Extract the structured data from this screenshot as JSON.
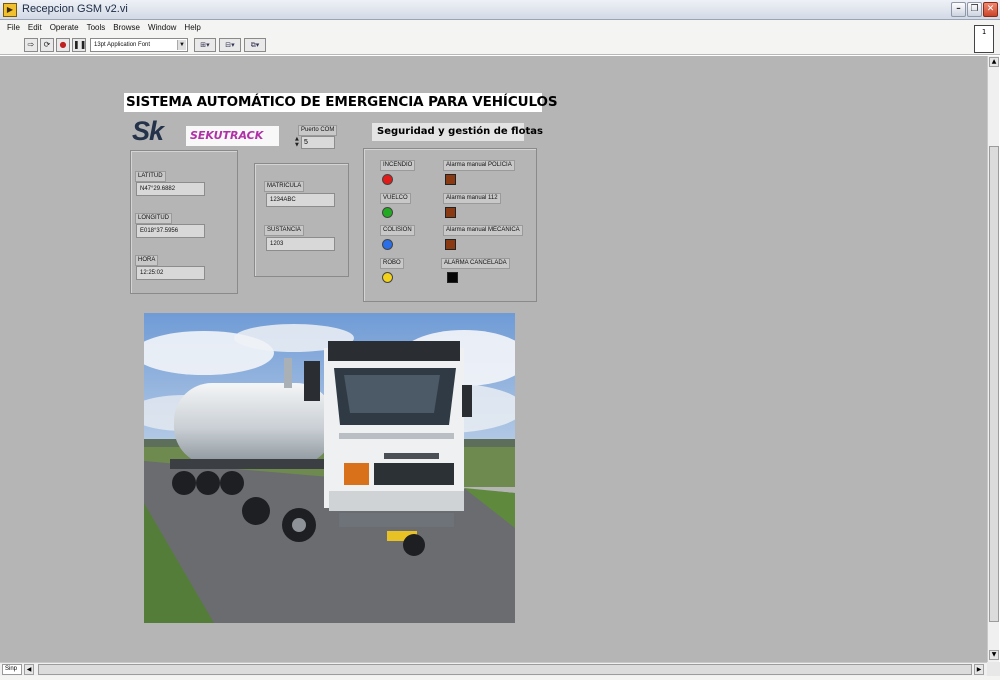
{
  "window": {
    "title": "Recepcion GSM v2.vi",
    "app_icon": "labview-icon",
    "controls": [
      "minimize",
      "maximize",
      "close"
    ]
  },
  "menu": [
    "File",
    "Edit",
    "Operate",
    "Tools",
    "Browse",
    "Window",
    "Help"
  ],
  "toolbar": {
    "font_select": "13pt Application Font",
    "buttons": [
      "run-arrow-icon",
      "run-continuous-icon",
      "abort-icon",
      "pause-icon"
    ],
    "menu_buttons": [
      "align-icon",
      "distribute-icon",
      "reorder-icon"
    ]
  },
  "vi_icon_text": "1",
  "panel": {
    "main_title": "SISTEMA AUTOMÁTICO DE EMERGENCIA PARA VEHÍCULOS",
    "logo_sk": "Sk",
    "logo_brand": "SEKUTRACK",
    "port": {
      "label": "Puerto COM",
      "value": "5"
    },
    "subtitle": "Seguridad y gestión de flotas",
    "gps": {
      "lat_label": "LATITUD",
      "lat_value": "N47°29.6882",
      "lon_label": "LONGITUD",
      "lon_value": "E018°37.5956",
      "time_label": "HORA",
      "time_value": "12:25:02"
    },
    "vehicle": {
      "plate_label": "MATRICULA",
      "plate_value": "1234ABC",
      "substance_label": "SUSTANCIA",
      "substance_value": "1203"
    },
    "alarms": {
      "incendio": "INCENDIO",
      "vuelco": "VUELCO",
      "colision": "COLISION",
      "robo": "ROBO",
      "manual_policia": "Alarma manual POLICIA",
      "manual_112": "Alarma manual 112",
      "manual_mecanica": "Alarma manual MECANICA",
      "cancelada": "ALARMA CANCELADA"
    },
    "led_colors": {
      "incendio": "#e11a1a",
      "vuelco": "#22aa22",
      "colision": "#2a6ee8",
      "robo": "#f2d21c",
      "manual": "#8a3a12",
      "cancelada": "#050505"
    }
  },
  "scrollbar": {
    "label": "Sinp"
  }
}
